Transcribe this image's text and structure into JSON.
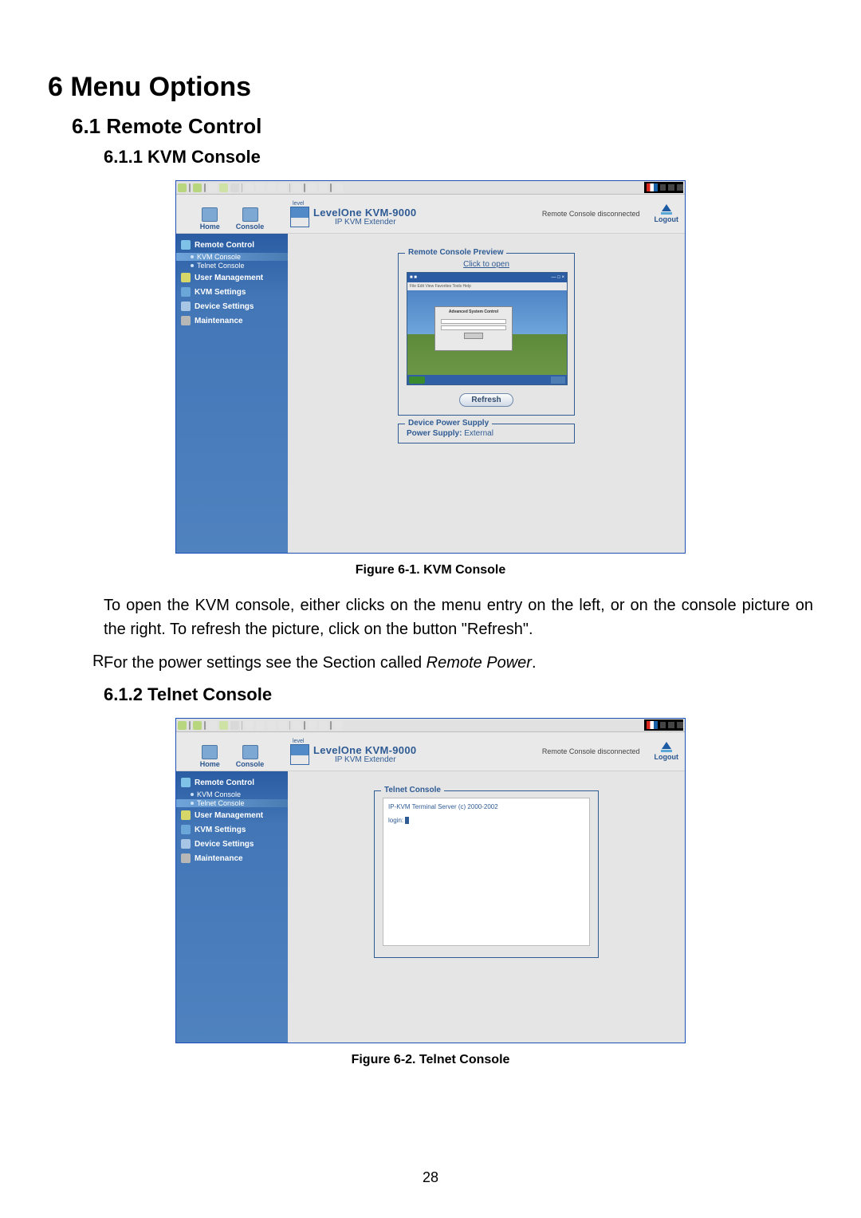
{
  "page_number": "28",
  "headings": {
    "h1": "6   Menu Options",
    "h2": "6.1     Remote Control",
    "h3a": "6.1.1    KVM Console",
    "h3b": "6.1.2    Telnet Console"
  },
  "captions": {
    "fig1": "Figure 6-1. KVM Console",
    "fig2": "Figure 6-2. Telnet Console"
  },
  "paragraphs": {
    "p1": "To open the KVM console, either clicks on the menu entry on the left, or on the console picture on the right. To refresh the picture, click on the button \"Refresh\".",
    "p2_prefix": "For the power settings see the Section called ",
    "p2_italic": "Remote Power",
    "p2_suffix": "."
  },
  "side_R": "R",
  "app": {
    "brand_small": "level",
    "product_title": "LevelOne KVM-9000",
    "product_sub": "IP KVM Extender",
    "status": "Remote Console disconnected",
    "hdr_buttons": {
      "home": "Home",
      "console": "Console",
      "logout": "Logout"
    },
    "sidebar": {
      "remote_control": "Remote Control",
      "kvm_console": "KVM Console",
      "telnet_console": "Telnet Console",
      "user_management": "User Management",
      "kvm_settings": "KVM Settings",
      "device_settings": "Device Settings",
      "maintenance": "Maintenance"
    },
    "kvm_panel": {
      "preview_legend": "Remote Console Preview",
      "click_to_open": "Click to open",
      "refresh": "Refresh",
      "power_legend": "Device Power Supply",
      "power_label": "Power Supply:",
      "power_value": "External",
      "thumb_dialog_title": "Advanced System Control",
      "thumb_menu": "File  Edit  View  Favorites  Tools  Help"
    },
    "telnet_panel": {
      "legend": "Telnet Console",
      "banner": "IP-KVM Terminal Server (c) 2000-2002",
      "prompt": "login:"
    }
  }
}
